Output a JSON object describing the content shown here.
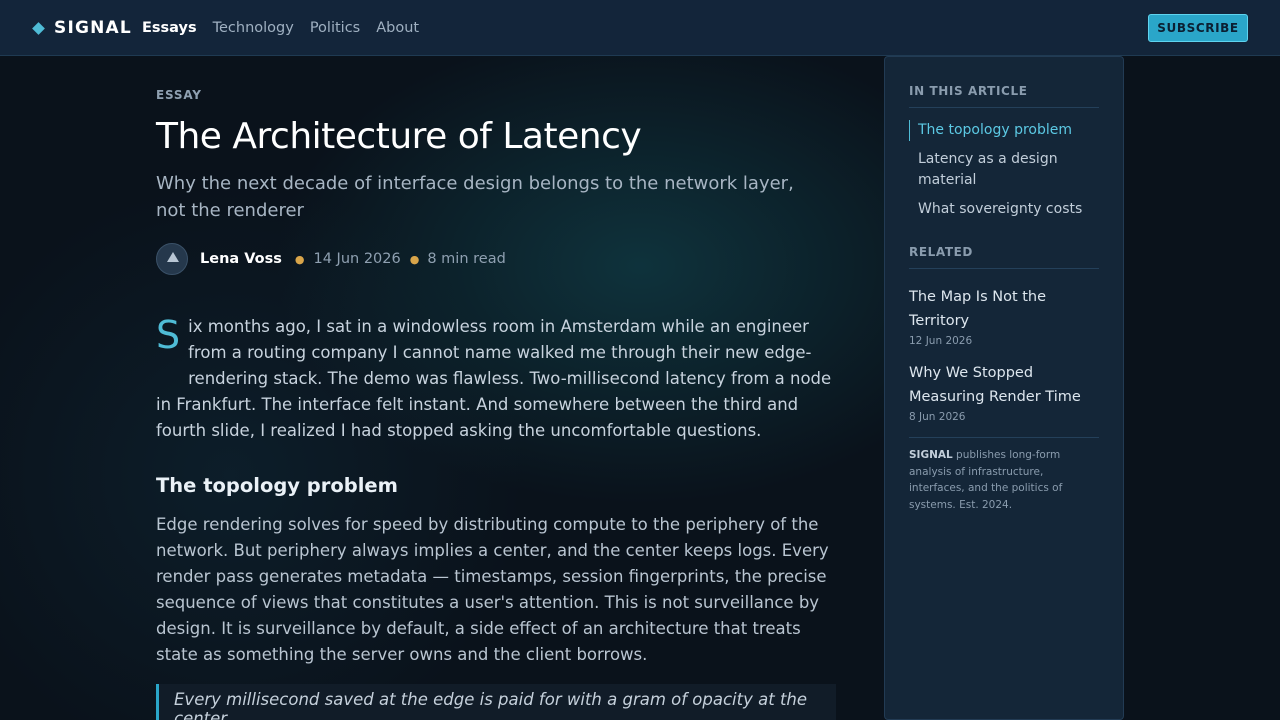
{
  "header": {
    "brand": "SIGNAL",
    "nav": [
      {
        "label": "Essays",
        "active": true
      },
      {
        "label": "Technology",
        "active": false
      },
      {
        "label": "Politics",
        "active": false
      },
      {
        "label": "About",
        "active": false
      }
    ],
    "subscribe_label": "SUBSCRIBE"
  },
  "article": {
    "kicker": "ESSAY",
    "title": "The Architecture of Latency",
    "dek": "Why the next decade of interface design belongs to the network layer, not the renderer",
    "author": "Lena Voss",
    "date": "14 Jun 2026",
    "read_time": "8 min read",
    "dropcap": "S",
    "lede": "ix months ago, I sat in a windowless room in Amsterdam while an engineer from a routing company I cannot name walked me through their new edge-rendering stack. The demo was flawless. Two-millisecond latency from a node in Frankfurt. The interface felt instant. And somewhere between the third and fourth slide, I realized I had stopped asking the uncomfortable questions.",
    "section_heading": "The topology problem",
    "section_body": "Edge rendering solves for speed by distributing compute to the periphery of the network. But periphery always implies a center, and the center keeps logs. Every render pass generates metadata — timestamps, session fingerprints, the precise sequence of views that constitutes a user's attention. This is not surveillance by design. It is surveillance by default, a side effect of an architecture that treats state as something the server owns and the client borrows.",
    "pull_quote": "Every millisecond saved at the edge is paid for with a gram of opacity at the center."
  },
  "sidebar": {
    "toc_heading": "IN THIS ARTICLE",
    "toc": [
      {
        "label": "The topology problem",
        "active": true
      },
      {
        "label": "Latency as a design material",
        "active": false
      },
      {
        "label": "What sovereignty costs",
        "active": false
      }
    ],
    "related_heading": "RELATED",
    "related": [
      {
        "title": "The Map Is Not the Territory",
        "date": "12 Jun 2026"
      },
      {
        "title": "Why We Stopped Measuring Render Time",
        "date": "8 Jun 2026"
      }
    ],
    "about_brand": "SIGNAL",
    "about_text": " publishes long-form analysis of infrastructure, interfaces, and the politics of systems. Est. 2024."
  },
  "colors": {
    "accent": "#4fbcd6",
    "header_bg": "#13253a",
    "page_bg": "#0a121b",
    "byline_dot": "#d9a54a"
  }
}
